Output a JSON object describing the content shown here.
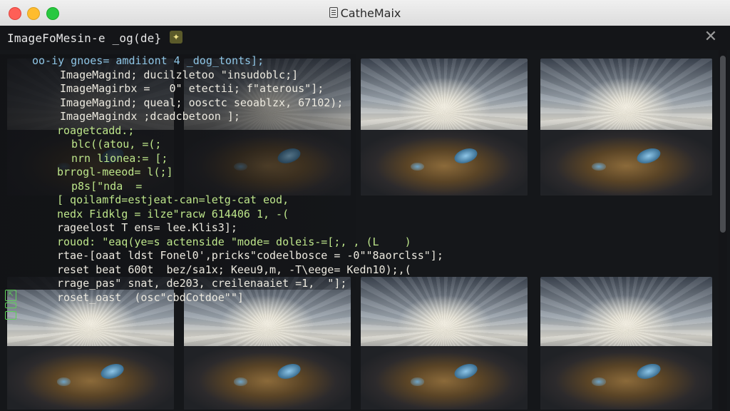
{
  "window": {
    "title": "CatheMaix"
  },
  "tab": {
    "label": "ImageFoMesin-e _og(de}",
    "badge_icon": "sparkle-icon",
    "close_icon": "close-icon"
  },
  "code_lines": [
    {
      "text": "oo-iy gnoes= amdiiont 4 _dog_tonts];",
      "color": "c-cyan",
      "indent": 45
    },
    {
      "text": "ImageMagind; ducilzletoo \"insudoblc;]",
      "color": "c-white",
      "indent": 84
    },
    {
      "text": "ImageMagirbx =   0\" etectii; f\"aterous\"];",
      "color": "c-white",
      "indent": 84
    },
    {
      "text": "ImageMagind; queal; oosctc seoablzx, 67102);",
      "color": "c-white",
      "indent": 84
    },
    {
      "text": "ImageMagindx ;dcadcbetoon ];",
      "color": "c-white",
      "indent": 84
    },
    {
      "text": "roagetcadd.;",
      "color": "c-green",
      "indent": 80
    },
    {
      "text": "blc((atou, =(;",
      "color": "c-green",
      "indent": 100
    },
    {
      "text": "nrn lionea:= [;",
      "color": "c-green",
      "indent": 100
    },
    {
      "text": "brrogl-meeod= l(;]",
      "color": "c-green",
      "indent": 80
    },
    {
      "text": "p8s[\"ndа  =",
      "color": "c-green",
      "indent": 100
    },
    {
      "text": "[ qoilamfd=estjeat-can=letg-cat eod,",
      "color": "c-green",
      "indent": 80
    },
    {
      "text": "nedx Fidklg = ilze\"racw 614406 1, -(",
      "color": "c-green",
      "indent": 80
    },
    {
      "text": "rageelost T ens= lee.Klis3];",
      "color": "c-white",
      "indent": 80
    },
    {
      "text": "rouod: \"eaq(ye=s actenside \"mode= doleis-=[;, , (L    )",
      "color": "c-green",
      "indent": 80
    },
    {
      "text": "rtae-[oaat ldst Fonel0',pricks\"codeelbosce = -0\"\"8aorclss\"];",
      "color": "c-white",
      "indent": 80
    },
    {
      "text": "reset beat 600t  bez/sa1x; Keeu9,m, -T\\eege= Kedn10);,(",
      "color": "c-white",
      "indent": 80
    },
    {
      "text": "rrage_pas\" snat, de203, creilenaaiet =1,  \"];",
      "color": "c-white",
      "indent": 80
    },
    {
      "text": "roset_oast  (osc\"cbdCotdoe\"\"]",
      "color": "c-white",
      "indent": 80
    }
  ],
  "thumbnails": [
    {
      "name": "thumbnail-1-1"
    },
    {
      "name": "thumbnail-1-2"
    },
    {
      "name": "thumbnail-1-3"
    },
    {
      "name": "thumbnail-1-4"
    },
    {
      "name": "thumbnail-2-1"
    },
    {
      "name": "thumbnail-2-2"
    },
    {
      "name": "thumbnail-2-3"
    },
    {
      "name": "thumbnail-2-4"
    }
  ]
}
